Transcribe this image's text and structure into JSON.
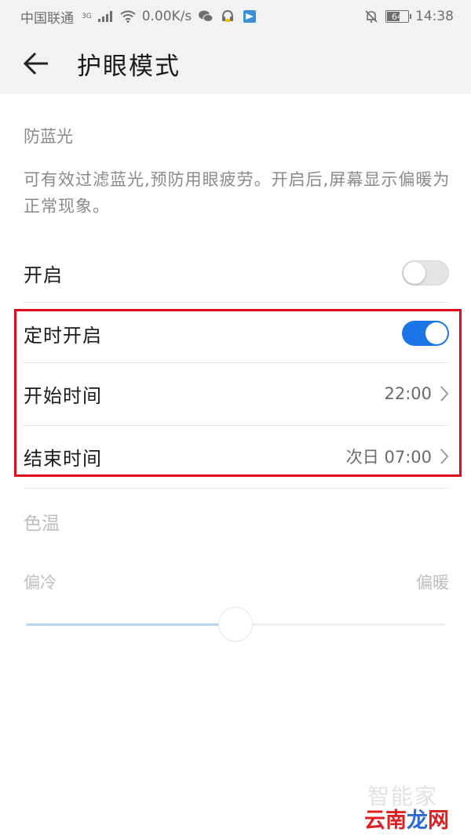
{
  "status_bar": {
    "carrier": "中国联通",
    "network": "3G",
    "speed": "0.00K/s",
    "battery": "64",
    "battery_level": 0.64,
    "time": "14:38"
  },
  "header": {
    "title": "护眼模式"
  },
  "blue_light": {
    "section_title": "防蓝光",
    "description": "可有效过滤蓝光,预防用眼疲劳。开启后,屏幕显示偏暖为正常现象。",
    "enable_label": "开启",
    "enable_on": false
  },
  "schedule": {
    "label": "定时开启",
    "on": true,
    "start_label": "开始时间",
    "start_value": "22:00",
    "end_label": "结束时间",
    "end_value": "次日 07:00"
  },
  "color_temp": {
    "section_title": "色温",
    "cold_label": "偏冷",
    "warm_label": "偏暖",
    "level": 0.5
  },
  "watermark": {
    "top": "智能家",
    "red": "云南",
    "blue": "龙",
    "red2": "网"
  },
  "colors": {
    "accent": "#1b75e6",
    "highlight": "#e00b1c"
  }
}
